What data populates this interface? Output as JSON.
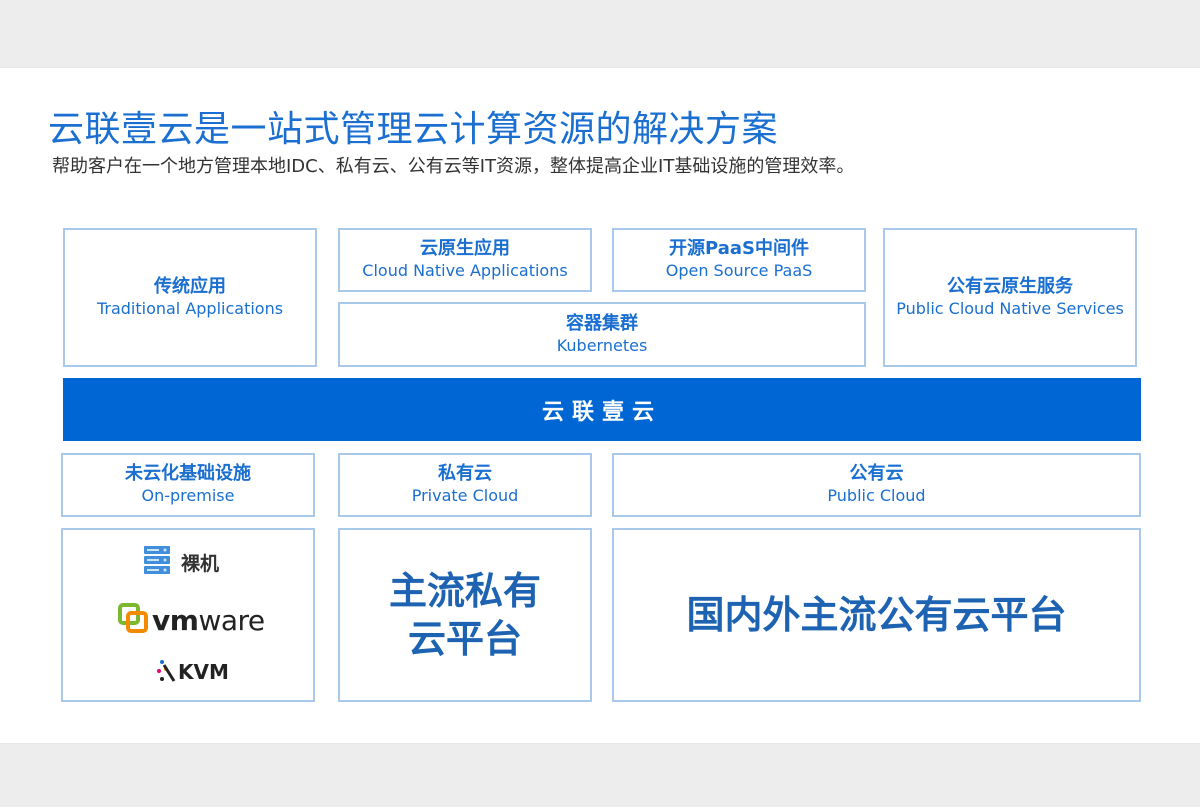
{
  "title": "云联壹云是一站式管理云计算资源的解决方案",
  "subtitle": "帮助客户在一个地方管理本地IDC、私有云、公有云等IT资源，整体提高企业IT基础设施的管理效率。",
  "top_layer": {
    "traditional": {
      "zh": "传统应用",
      "en": "Traditional Applications"
    },
    "cloud_native": {
      "zh": "云原生应用",
      "en": "Cloud Native Applications"
    },
    "open_source": {
      "zh": "开源PaaS中间件",
      "en": "Open Source PaaS"
    },
    "public_native": {
      "zh": "公有云原生服务",
      "en": "Public Cloud Native Services"
    },
    "kubernetes": {
      "zh": "容器集群",
      "en": "Kubernetes"
    }
  },
  "band": {
    "label": "云联壹云",
    "color": "#0066d4"
  },
  "lower_layer": {
    "onpremise": {
      "zh": "未云化基础设施",
      "en": "On-premise"
    },
    "private": {
      "zh": "私有云",
      "en": "Private Cloud"
    },
    "public": {
      "zh": "公有云",
      "en": "Public Cloud"
    }
  },
  "bottom": {
    "baremetal_label": "裸机",
    "vmware_vm": "vm",
    "vmware_ware": "ware",
    "kvm_label": "KVM",
    "private_line1": "主流私有",
    "private_line2": "云平台",
    "public_text": "国内外主流公有云平台"
  },
  "colors": {
    "accent": "#1a6fd0",
    "border": "#a9c9ea",
    "band": "#0066d4"
  }
}
